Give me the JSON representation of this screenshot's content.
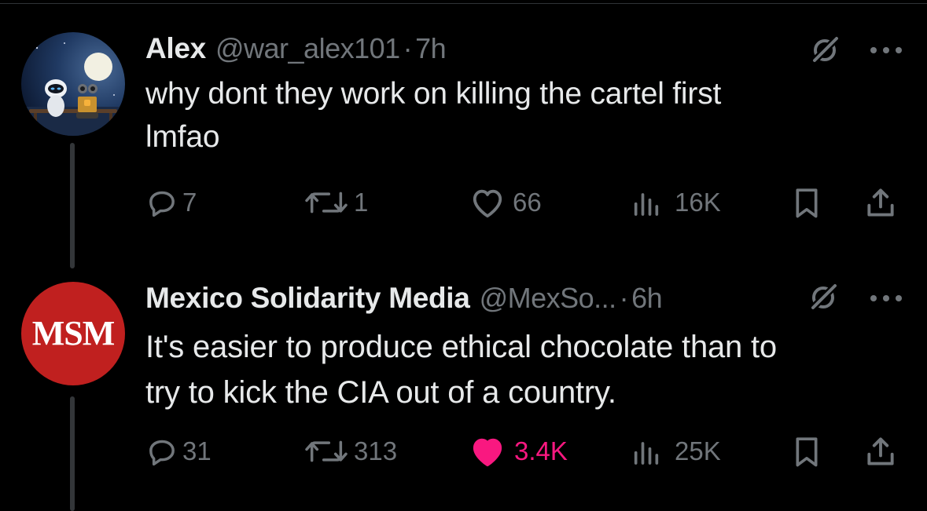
{
  "tweets": [
    {
      "name": "Alex",
      "handle": "@war_alex101",
      "time": "7h",
      "text_line1": "why dont they work on killing the cartel first",
      "text_line2": "lmfao",
      "replies": "7",
      "reposts": "1",
      "likes": "66",
      "views": "16K",
      "liked": false,
      "avatar": "wall-e-eve-picture"
    },
    {
      "name": "Mexico Solidarity Media",
      "handle": "@MexSo...",
      "time": "6h",
      "text_line1": "It's easier to produce ethical chocolate than to",
      "text_line2": "try to kick the CIA out of a country.",
      "replies": "31",
      "reposts": "313",
      "likes": "3.4K",
      "views": "25K",
      "liked": true,
      "avatar_text": "MSM",
      "avatar_color": "#c0201f"
    }
  ],
  "colors": {
    "background": "#000000",
    "text": "#e7e9ea",
    "muted": "#71767b",
    "like_active": "#f91880",
    "thread_line": "#333639"
  },
  "icons": [
    "grok-icon",
    "more-icon",
    "reply-icon",
    "repost-icon",
    "like-icon",
    "views-icon",
    "bookmark-icon",
    "share-icon"
  ]
}
